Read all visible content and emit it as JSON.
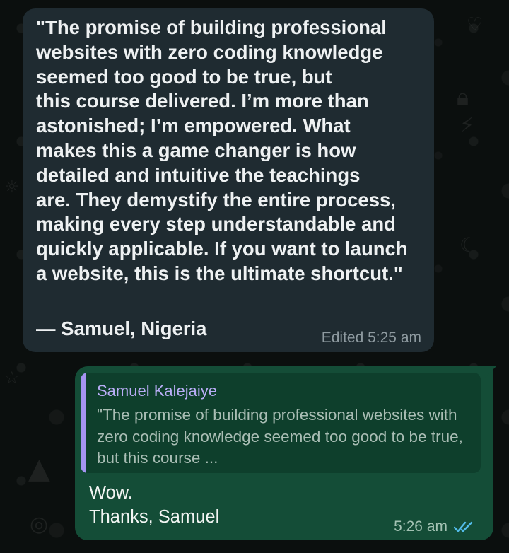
{
  "incoming": {
    "text": "\"The promise of building professional\nwebsites with zero coding knowledge\nseemed too good to be true, but\nthis course delivered. I’m more than\nastonished; I’m empowered. What\nmakes this a game changer is how\ndetailed and intuitive the teachings\nare. They demystify the entire process,\nmaking every step understandable and\nquickly applicable. If you want to launch\na website, this is the ultimate shortcut.\"",
    "signature": "— Samuel, Nigeria",
    "edited_label": "Edited",
    "time": "5:25 am"
  },
  "outgoing": {
    "quote_author": "Samuel Kalejaiye",
    "quote_preview": "\"The promise of building professional websites with zero coding knowledge seemed too good to be true, but this course ...",
    "text": "Wow.\nThanks, Samuel",
    "time": "5:26 am",
    "status_icon": "double-check-icon",
    "status_color": "#53bdeb"
  },
  "colors": {
    "background": "#0b0f0e",
    "incoming_bubble": "#1f2b31",
    "outgoing_bubble": "#144d37",
    "quote_bar": "#a594f2"
  }
}
